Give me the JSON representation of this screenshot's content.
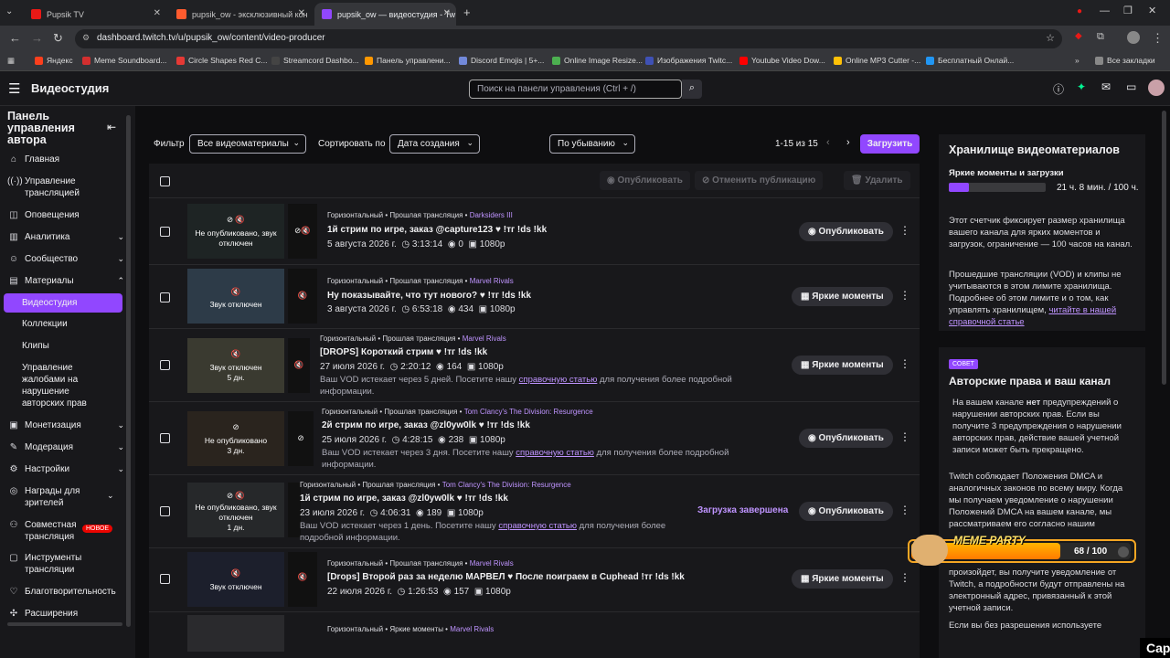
{
  "browser": {
    "tabs": [
      {
        "label": "Pupsik TV",
        "color": "#e91916"
      },
      {
        "label": "pupsik_ow - эксклюзивный кон",
        "color": "#ff5b2e"
      },
      {
        "label": "pupsik_ow — видеостудия - Tw",
        "color": "#9147ff"
      }
    ],
    "url": "dashboard.twitch.tv/u/pupsik_ow/content/video-producer",
    "bookmarks": [
      {
        "label": "Яндекс",
        "color": "#fc3f1d"
      },
      {
        "label": "Meme Soundboard...",
        "color": "#d32f2f"
      },
      {
        "label": "Circle Shapes Red C...",
        "color": "#e53935"
      },
      {
        "label": "Streamcord Dashbo...",
        "color": "#444444"
      },
      {
        "label": "Панель управлени...",
        "color": "#ff9800"
      },
      {
        "label": "Discord Emojis | 5+...",
        "color": "#7289da"
      },
      {
        "label": "Online Image Resize...",
        "color": "#4caf50"
      },
      {
        "label": "Изображения Twitc...",
        "color": "#3f51b5"
      },
      {
        "label": "Youtube Video Dow...",
        "color": "#ff0000"
      },
      {
        "label": "Online MP3 Cutter -...",
        "color": "#ffc107"
      },
      {
        "label": "Бесплатный Онлай...",
        "color": "#2196f3"
      }
    ],
    "all_bookmarks": "Все закладки"
  },
  "header": {
    "title": "Видеостудия",
    "search_placeholder": "Поиск на панели управления (Ctrl + /)"
  },
  "sidebar": {
    "title": "Панель управления автора",
    "items": [
      {
        "label": "Главная",
        "icon": "home-icon"
      },
      {
        "label": "Управление трансляцией",
        "icon": "broadcast-icon"
      },
      {
        "label": "Оповещения",
        "icon": "alert-icon"
      },
      {
        "label": "Аналитика",
        "icon": "chart-icon"
      },
      {
        "label": "Сообщество",
        "icon": "community-icon"
      },
      {
        "label": "Материалы",
        "icon": "content-icon"
      }
    ],
    "sub_items": [
      "Видеостудия",
      "Коллекции",
      "Клипы",
      "Управление жалобами на нарушение авторских прав"
    ],
    "items2": [
      {
        "label": "Монетизация",
        "icon": "money-icon"
      },
      {
        "label": "Модерация",
        "icon": "moderation-icon"
      },
      {
        "label": "Настройки",
        "icon": "settings-icon"
      },
      {
        "label": "Награды для зрителей",
        "icon": "rewards-icon"
      },
      {
        "label": "Совместная трансляция",
        "icon": "collab-icon",
        "badge": "НОВОЕ"
      },
      {
        "label": "Инструменты трансляции",
        "icon": "tools-icon"
      },
      {
        "label": "Благотворительность",
        "icon": "charity-icon"
      },
      {
        "label": "Расширения",
        "icon": "extensions-icon"
      }
    ]
  },
  "toolbar": {
    "filter_label": "Фильтр",
    "filter_value": "Все видеоматериалы",
    "sort_label": "Сортировать по",
    "sort_value": "Дата создания",
    "order_value": "По убыванию",
    "pagination": "1-15 из 15",
    "upload": "Загрузить",
    "publish": "Опубликовать",
    "unpublish": "Отменить публикацию",
    "delete": "Удалить"
  },
  "videos": [
    {
      "meta": "Горизонтальный • Прошлая трансляция • ",
      "game": "Darksiders III",
      "title": "1й стрим по игре, заказ @capture123 ♥ !тг !ds !kk",
      "date": "5 августа 2026 г.",
      "duration": "3:13:14",
      "views": "0",
      "quality": "1080p",
      "thumb": "Не опубликовано, звук отключен",
      "action": "Опубликовать"
    },
    {
      "meta": "Горизонтальный • Прошлая трансляция • ",
      "game": "Marvel Rivals",
      "title": "Ну показывайте, что тут нового? ♥ !тг !ds !kk",
      "date": "3 августа 2026 г.",
      "duration": "6:53:18",
      "views": "434",
      "quality": "1080p",
      "thumb": "Звук отключен",
      "action": "Яркие моменты"
    },
    {
      "meta": "Горизонтальный • Прошлая трансляция • ",
      "game": "Marvel Rivals",
      "title": "[DROPS] Короткий стрим ♥ !тг !ds !kk",
      "date": "27 июля 2026 г.",
      "duration": "2:20:12",
      "views": "164",
      "quality": "1080p",
      "thumb": "Звук отключен",
      "days": "5 дн.",
      "warn_a": "Ваш VOD истекает через 5 дней. Посетите нашу ",
      "warn_link": "справочную статью",
      "warn_b": " для получения более подробной информации.",
      "action": "Яркие моменты"
    },
    {
      "meta": "Горизонтальный • Прошлая трансляция • ",
      "game": "Tom Clancy's The Division: Resurgence",
      "title": "2й стрим по игре, заказ @zl0yw0lk ♥ !тг !ds !kk",
      "date": "25 июля 2026 г.",
      "duration": "4:28:15",
      "views": "238",
      "quality": "1080p",
      "thumb": "Не опубликовано",
      "days": "3 дн.",
      "warn_a": "Ваш VOD истекает через 3 дня. Посетите нашу ",
      "warn_link": "справочную статью",
      "warn_b": " для получения более подробной информации.",
      "action": "Опубликовать"
    },
    {
      "meta": "Горизонтальный • Прошлая трансляция • ",
      "game": "Tom Clancy's The Division: Resurgence",
      "title": "1й стрим по игре, заказ @zl0yw0lk ♥ !тг !ds !kk",
      "date": "23 июля 2026 г.",
      "duration": "4:06:31",
      "views": "189",
      "quality": "1080p",
      "thumb": "Не опубликовано, звук отключен",
      "days": "1 дн.",
      "warn_a": "Ваш VOD истекает через 1 день. Посетите нашу ",
      "warn_link": "справочную статью",
      "warn_b": " для получения более подробной информации.",
      "status": "Загрузка завершена",
      "action": "Опубликовать"
    },
    {
      "meta": "Горизонтальный • Прошлая трансляция • ",
      "game": "Marvel Rivals",
      "title": "[Drops] Второй раз за неделю МАРВЕЛ ♥ После поиграем в Cuphead !тг !ds !kk",
      "date": "22 июля 2026 г.",
      "duration": "1:26:53",
      "views": "157",
      "quality": "1080p",
      "thumb": "Звук отключен",
      "action": "Яркие моменты"
    },
    {
      "meta": "Горизонтальный • Яркие моменты • ",
      "game": "Marvel Rivals"
    }
  ],
  "storage": {
    "title": "Хранилище видеоматериалов",
    "label": "Яркие моменты и загрузки",
    "usage": "21 ч. 8 мин. / 100 ч.",
    "fill_fraction": 0.21,
    "p1": "Этот счетчик фиксирует размер хранилища вашего канала для ярких моментов и загрузок, ограничение — 100 часов на канал.",
    "p2": "Прошедшие трансляции (VOD) и клипы не учитываются в этом лимите хранилища. Подробнее об этом лимите и о том, как управлять хранилищем, ",
    "p2_link": "читайте в нашей справочной статье"
  },
  "tip": {
    "badge": "СОВЕТ",
    "title": "Авторские права и ваш канал",
    "p1_a": "На вашем канале ",
    "p1_bold": "нет",
    "p1_b": " предупреждений о нарушении авторских прав. Если вы получите 3 предупреждения о нарушении авторских прав, действие вашей учетной записи может быть прекращено.",
    "p2": "Twitch соблюдает Положения DMCA и аналогичных законов по всему миру. Когда мы получаем уведомление о нарушении Положений DMCA на вашем канале, мы рассматриваем его согласно нашим",
    "p3": "произойдет, вы получите уведомление от Twitch, а подробности будут отправлены на электронный адрес, привязанный к этой учетной записи.",
    "p4": "Если вы без разрешения используете"
  },
  "overlay": {
    "title": "MEME PARTY",
    "count": "68 / 100",
    "fill_fraction": 0.68,
    "caption": "Cap"
  }
}
